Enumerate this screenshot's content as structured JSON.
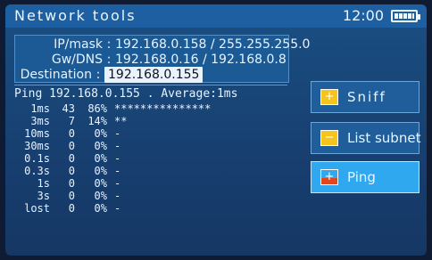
{
  "titlebar": {
    "title": "Network tools",
    "time": "12:00",
    "battery_icon": "battery-icon"
  },
  "info": {
    "ipmask_label": "IP/mask",
    "ipmask_value": "192.168.0.158 / 255.255.255.0",
    "gwdns_label": "Gw/DNS",
    "gwdns_value": "192.168.0.16 / 192.168.0.8",
    "dest_label": "Destination",
    "dest_value": "192.168.0.155",
    "separator": ":"
  },
  "ping": {
    "header": "Ping 192.168.0.155 . Average:1ms",
    "rows": [
      {
        "time": "1ms",
        "count": "43",
        "pct": "86%",
        "bar": "***************"
      },
      {
        "time": "3ms",
        "count": "7",
        "pct": "14%",
        "bar": "**"
      },
      {
        "time": "10ms",
        "count": "0",
        "pct": "0%",
        "bar": "-"
      },
      {
        "time": "30ms",
        "count": "0",
        "pct": "0%",
        "bar": "-"
      },
      {
        "time": "0.1s",
        "count": "0",
        "pct": "0%",
        "bar": "-"
      },
      {
        "time": "0.3s",
        "count": "0",
        "pct": "0%",
        "bar": "-"
      },
      {
        "time": "1s",
        "count": "0",
        "pct": "0%",
        "bar": "-"
      },
      {
        "time": "3s",
        "count": "0",
        "pct": "0%",
        "bar": "-"
      },
      {
        "time": "lost",
        "count": "0",
        "pct": "0%",
        "bar": "-"
      }
    ]
  },
  "buttons": {
    "sniff": {
      "label": "Sniff",
      "icon_glyph": "+",
      "icon": "plus-icon"
    },
    "list_subnet": {
      "label": "List subnet",
      "icon_glyph": "−",
      "icon": "minus-icon"
    },
    "ping": {
      "label": "Ping",
      "icon_glyph": "+",
      "icon": "plus-icon"
    }
  },
  "colors": {
    "background": "#173f70",
    "titlebar": "#1d5fa0",
    "selected_button": "#2fa8ef",
    "icon_yellow": "#f5c51e",
    "icon_red": "#e1471f"
  }
}
